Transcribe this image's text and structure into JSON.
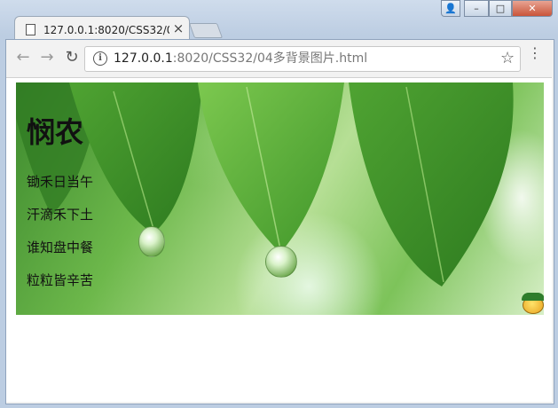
{
  "browser": {
    "tab_title": "127.0.0.1:8020/CSS32/04多背景图片.html",
    "tab_close_glyph": "×",
    "address_host": "127.0.0.1",
    "address_path": ":8020/CSS32/04多背景图片.html",
    "info_glyph": "i",
    "back_glyph": "←",
    "forward_glyph": "→",
    "reload_glyph": "↻",
    "bookmark_glyph": "☆",
    "menu_glyph": "⋮",
    "window_controls": {
      "user": "👤",
      "minimize": "–",
      "maximize": "□",
      "close": "✕"
    }
  },
  "page": {
    "heading": "悯农",
    "lines": [
      "锄禾日当午",
      "汗滴禾下土",
      "谁知盘中餐",
      "粒粒皆辛苦"
    ]
  }
}
